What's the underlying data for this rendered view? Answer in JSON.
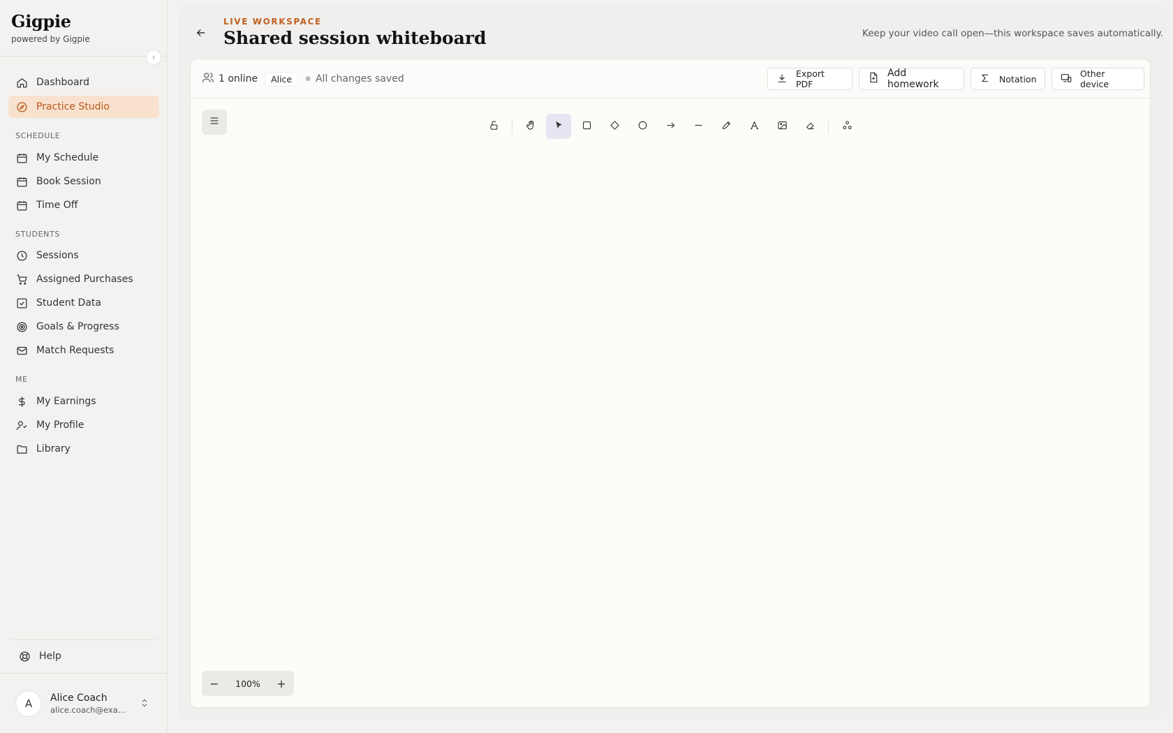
{
  "brand": {
    "name": "Gigpie",
    "tagline": "powered by Gigpie"
  },
  "sidebar": {
    "items_main": [
      {
        "label": "Dashboard",
        "icon": "home-icon"
      },
      {
        "label": "Practice Studio",
        "icon": "compass-icon",
        "active": true
      }
    ],
    "schedule_label": "SCHEDULE",
    "schedule_items": [
      {
        "label": "My Schedule",
        "icon": "calendar-icon"
      },
      {
        "label": "Book Session",
        "icon": "calendar-icon"
      },
      {
        "label": "Time Off",
        "icon": "calendar-icon"
      }
    ],
    "students_label": "STUDENTS",
    "students_items": [
      {
        "label": "Sessions",
        "icon": "clock-icon"
      },
      {
        "label": "Assigned Purchases",
        "icon": "cart-icon"
      },
      {
        "label": "Student Data",
        "icon": "checkbox-icon"
      },
      {
        "label": "Goals & Progress",
        "icon": "target-icon"
      },
      {
        "label": "Match Requests",
        "icon": "mail-icon"
      }
    ],
    "me_label": "ME",
    "me_items": [
      {
        "label": "My Earnings",
        "icon": "dollar-icon"
      },
      {
        "label": "My Profile",
        "icon": "user-icon"
      },
      {
        "label": "Library",
        "icon": "folder-icon"
      }
    ],
    "help_label": "Help",
    "user": {
      "initial": "A",
      "name": "Alice Coach",
      "email": "alice.coach@exam..."
    }
  },
  "header": {
    "eyebrow": "LIVE WORKSPACE",
    "title": "Shared session whiteboard",
    "hint": "Keep your video call open—this workspace saves automatically."
  },
  "panel": {
    "online": "1 online",
    "participant": "Alice",
    "save_status": "All changes saved",
    "buttons": {
      "export": "Export PDF",
      "homework": "Add homework",
      "notation": "Notation",
      "device": "Other device"
    },
    "zoom": {
      "level": "100%",
      "minus": "−",
      "plus": "+"
    },
    "tools": [
      "lock",
      "hand",
      "select",
      "rectangle",
      "diamond",
      "ellipse",
      "arrow",
      "line",
      "pencil",
      "text",
      "image",
      "eraser",
      "more-shapes"
    ],
    "active_tool": "select"
  },
  "colors": {
    "accent": "#c0601f",
    "active_nav_bg": "#f8e2cf",
    "canvas_bg": "#fdfcf8"
  }
}
